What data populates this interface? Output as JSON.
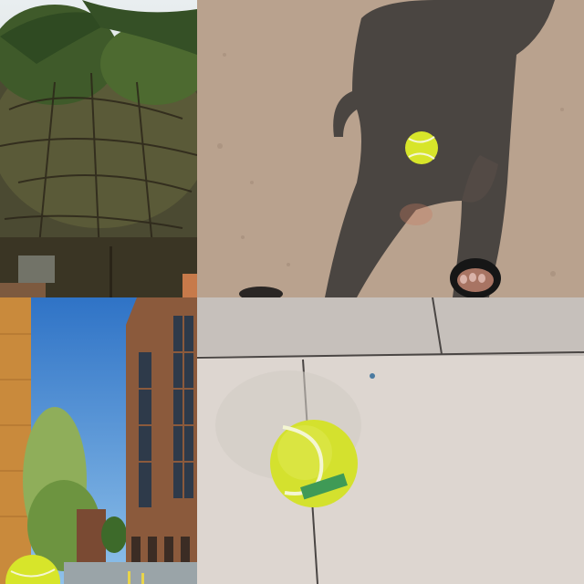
{
  "collage": {
    "tiles": [
      {
        "subject": "palm-tree-canopy"
      },
      {
        "subject": "shadow-with-tennis-ball"
      },
      {
        "subject": "brick-building-sky"
      },
      {
        "subject": "tennis-ball-on-pavement"
      }
    ]
  },
  "colors": {
    "ball": "#d7e52a",
    "ball_seam": "#f4f6d2",
    "pavement": "#b9a28e",
    "shadow": "#4a4541",
    "sky": "#3f86d8",
    "brick": "#8b5a3c",
    "foliage": "#3a4a24",
    "tile_floor": "#ddd6d0"
  }
}
